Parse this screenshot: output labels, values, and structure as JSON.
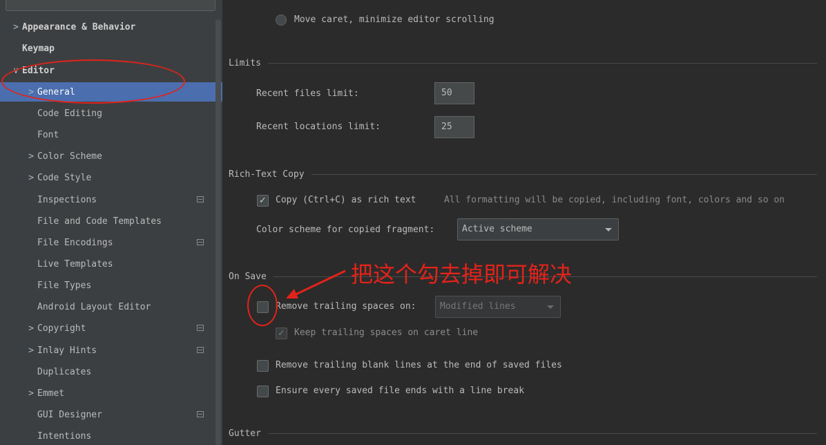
{
  "sidebar": {
    "items": [
      {
        "label": "Appearance & Behavior",
        "arrow": ">",
        "bold": true,
        "indent": 0
      },
      {
        "label": "Keymap",
        "arrow": "",
        "bold": true,
        "indent": 0
      },
      {
        "label": "Editor",
        "arrow": "∨",
        "bold": true,
        "indent": 0
      },
      {
        "label": "General",
        "arrow": ">",
        "bold": false,
        "indent": 1,
        "selected": true
      },
      {
        "label": "Code Editing",
        "arrow": "",
        "bold": false,
        "indent": 1
      },
      {
        "label": "Font",
        "arrow": "",
        "bold": false,
        "indent": 1
      },
      {
        "label": "Color Scheme",
        "arrow": ">",
        "bold": false,
        "indent": 1
      },
      {
        "label": "Code Style",
        "arrow": ">",
        "bold": false,
        "indent": 1
      },
      {
        "label": "Inspections",
        "arrow": "",
        "bold": false,
        "indent": 1,
        "badge": true
      },
      {
        "label": "File and Code Templates",
        "arrow": "",
        "bold": false,
        "indent": 1
      },
      {
        "label": "File Encodings",
        "arrow": "",
        "bold": false,
        "indent": 1,
        "badge": true
      },
      {
        "label": "Live Templates",
        "arrow": "",
        "bold": false,
        "indent": 1
      },
      {
        "label": "File Types",
        "arrow": "",
        "bold": false,
        "indent": 1
      },
      {
        "label": "Android Layout Editor",
        "arrow": "",
        "bold": false,
        "indent": 1
      },
      {
        "label": "Copyright",
        "arrow": ">",
        "bold": false,
        "indent": 1,
        "badge": true
      },
      {
        "label": "Inlay Hints",
        "arrow": ">",
        "bold": false,
        "indent": 1,
        "badge": true
      },
      {
        "label": "Duplicates",
        "arrow": "",
        "bold": false,
        "indent": 1
      },
      {
        "label": "Emmet",
        "arrow": ">",
        "bold": false,
        "indent": 1
      },
      {
        "label": "GUI Designer",
        "arrow": "",
        "bold": false,
        "indent": 1,
        "badge": true
      },
      {
        "label": "Intentions",
        "arrow": "",
        "bold": false,
        "indent": 1
      }
    ]
  },
  "content": {
    "move_caret_option": "Move caret, minimize editor scrolling",
    "limits": {
      "title": "Limits",
      "recent_files_label": "Recent files limit:",
      "recent_files_value": "50",
      "recent_locations_label": "Recent locations limit:",
      "recent_locations_value": "25"
    },
    "rich_text": {
      "title": "Rich-Text Copy",
      "copy_label": "Copy (Ctrl+C) as rich text",
      "copy_checked": true,
      "copy_hint": "All formatting will be copied, including font, colors and so on",
      "scheme_label": "Color scheme for copied fragment:",
      "scheme_value": "Active scheme"
    },
    "on_save": {
      "title": "On Save",
      "remove_trailing_label": "Remove trailing spaces on:",
      "remove_trailing_checked": false,
      "remove_trailing_value": "Modified lines",
      "keep_trailing_label": "Keep trailing spaces on caret line",
      "keep_trailing_checked": true,
      "remove_blank_label": "Remove trailing blank lines at the end of saved files",
      "remove_blank_checked": false,
      "ensure_break_label": "Ensure every saved file ends with a line break",
      "ensure_break_checked": false
    },
    "gutter": {
      "title": "Gutter"
    }
  },
  "annotation": {
    "note": "把这个勾去掉即可解决",
    "color": "#e2231a"
  },
  "colors": {
    "sidebar_bg": "#3c3f41",
    "content_bg": "#2b2b2b",
    "selection": "#4b6eaf"
  }
}
